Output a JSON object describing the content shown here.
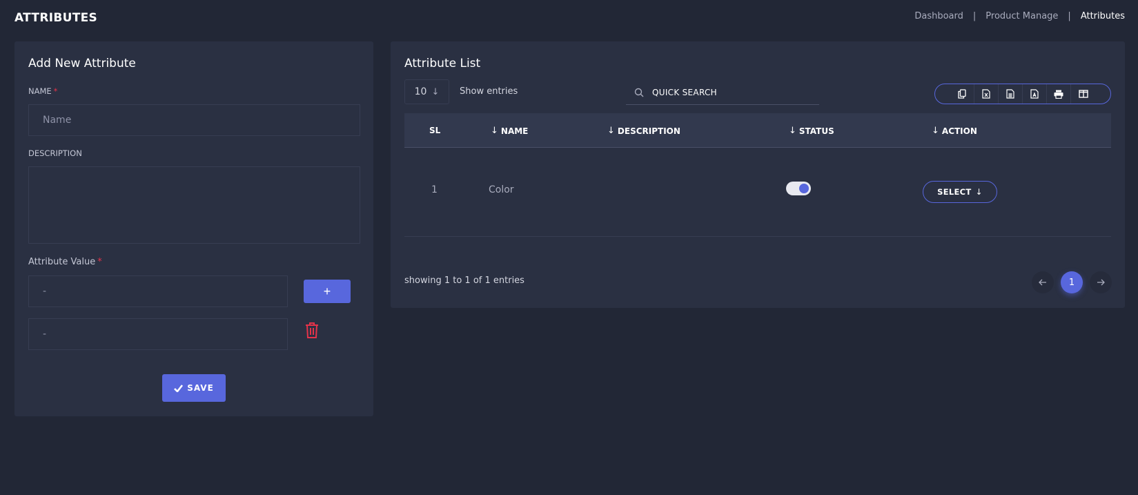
{
  "header": {
    "title": "ATTRIBUTES",
    "breadcrumb": [
      {
        "label": "Dashboard"
      },
      {
        "label": "Product Manage"
      },
      {
        "label": "Attributes"
      }
    ],
    "separator": "|"
  },
  "form": {
    "title": "Add New Attribute",
    "name_label": "NAME",
    "name_placeholder": "Name",
    "required_mark": "*",
    "description_label": "DESCRIPTION",
    "attribute_value_label": "Attribute Value",
    "attribute_values": [
      "-",
      "-"
    ],
    "add_label": "+",
    "save_label": "SAVE"
  },
  "list": {
    "title": "Attribute List",
    "entries_value": "10",
    "show_entries_label": "Show entries",
    "search_placeholder": "QUICK SEARCH",
    "export_icons": [
      "copy-icon",
      "excel-icon",
      "csv-icon",
      "pdf-icon",
      "print-icon",
      "columns-icon"
    ],
    "columns": [
      "SL",
      "NAME",
      "DESCRIPTION",
      "STATUS",
      "ACTION"
    ],
    "rows": [
      {
        "sl": "1",
        "name": "Color",
        "description": "",
        "status": true,
        "action": "SELECT"
      }
    ],
    "showing_text": "showing 1 to 1 of 1 entries",
    "pagination": {
      "current": "1",
      "prev_icon": "arrow-left-icon",
      "next_icon": "arrow-right-icon"
    }
  },
  "colors": {
    "accent": "#5867dd",
    "danger": "#e5334a",
    "background": "#222736",
    "card": "#2a3042"
  }
}
